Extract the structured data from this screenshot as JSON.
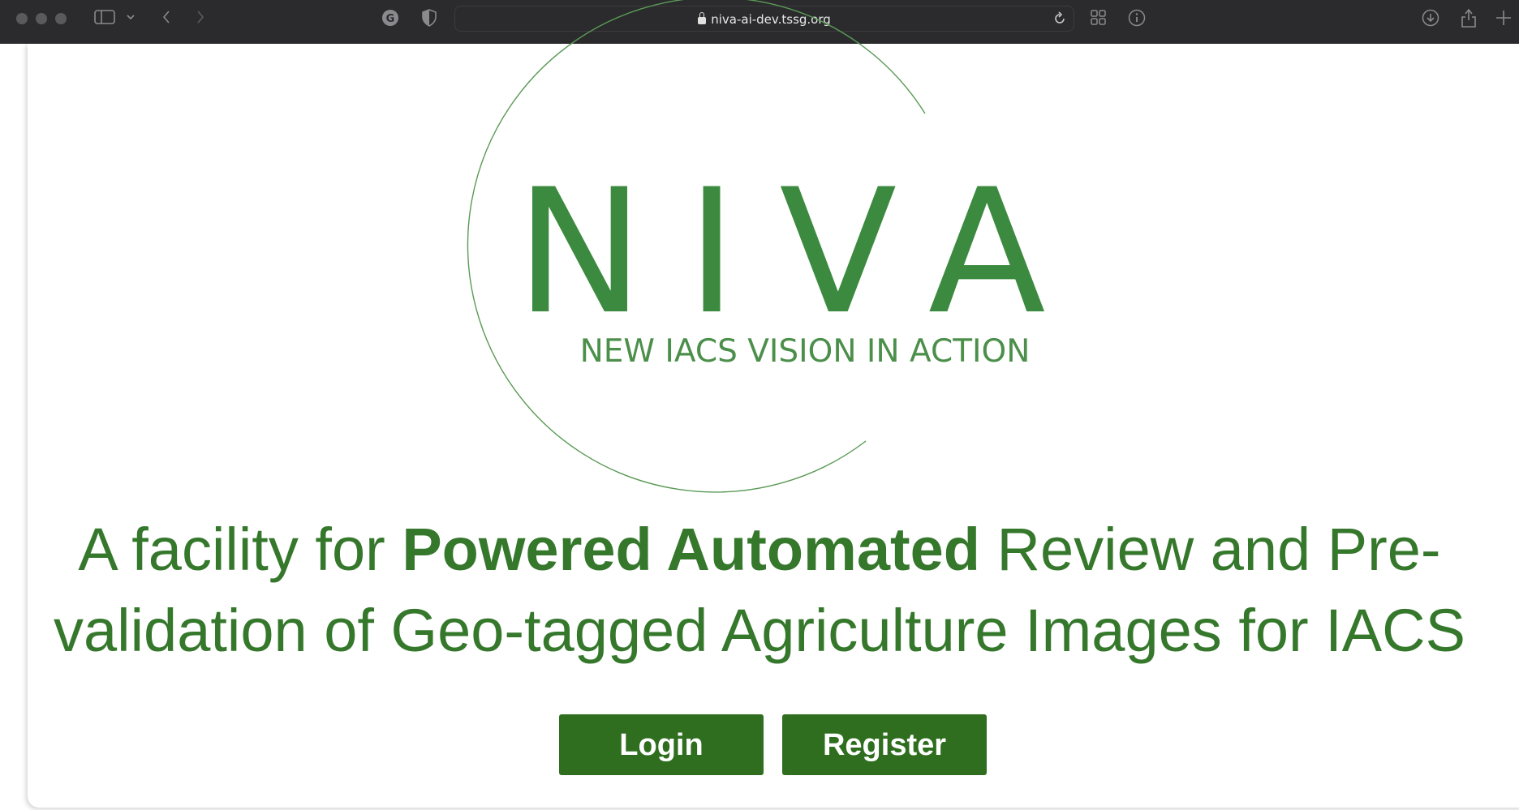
{
  "browser": {
    "url": "niva-ai-dev.tssg.org"
  },
  "logo": {
    "wordmark": "NIVA",
    "subtitle": "NEW IACS VISION IN ACTION"
  },
  "hero": {
    "tagline_part1": "A facility for ",
    "tagline_bold": "Powered Automated",
    "tagline_part2": " Review and Pre-",
    "tagline_line2": "validation of Geo-tagged Agriculture Images for IACS"
  },
  "actions": {
    "login_label": "Login",
    "register_label": "Register"
  },
  "colors": {
    "brand_green": "#35782c",
    "button_green": "#2e6e1e",
    "toolbar_bg": "#2b2b2d"
  }
}
